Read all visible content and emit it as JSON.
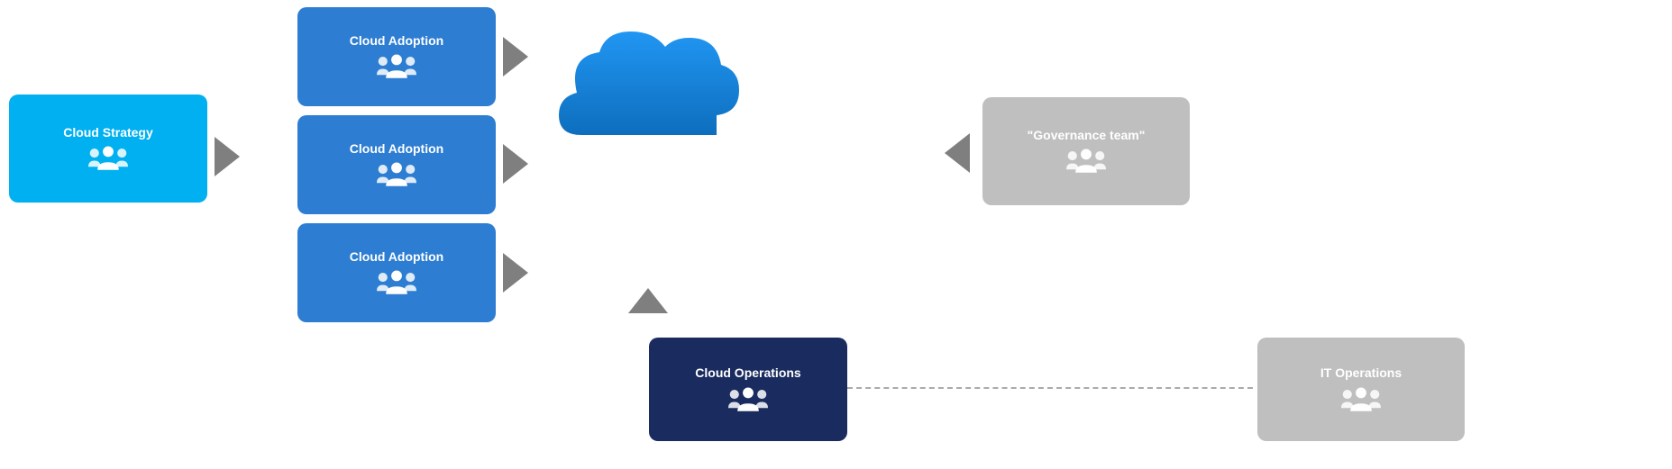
{
  "boxes": {
    "cloud_strategy": {
      "label": "Cloud Strategy",
      "type": "blue-bright"
    },
    "cloud_adoption_1": {
      "label": "Cloud Adoption",
      "type": "blue-medium"
    },
    "cloud_adoption_2": {
      "label": "Cloud Adoption",
      "type": "blue-medium"
    },
    "cloud_adoption_3": {
      "label": "Cloud Adoption",
      "type": "blue-medium"
    },
    "cloud_operations": {
      "label": "Cloud Operations",
      "type": "blue-dark"
    },
    "governance_team": {
      "label": "\"Governance team\"",
      "type": "gray"
    },
    "it_operations": {
      "label": "IT Operations",
      "type": "gray"
    }
  },
  "cloud": {
    "color": "#1e90d6"
  }
}
